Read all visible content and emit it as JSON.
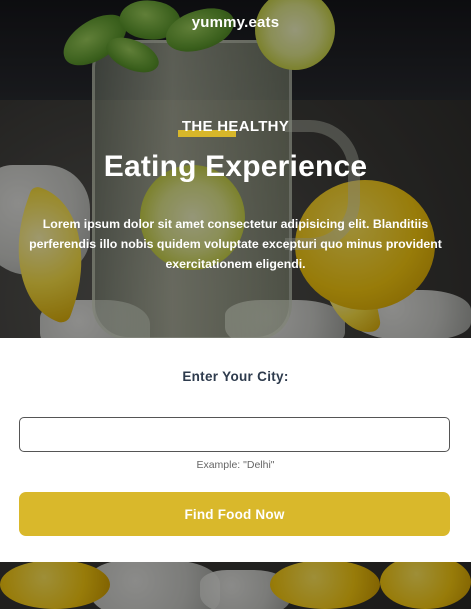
{
  "header": {
    "brand": "yummy.eats"
  },
  "hero": {
    "subtitle": "THE HEALTHY",
    "title": "Eating Experience",
    "description": "Lorem ipsum dolor sit amet consectetur adipisicing elit. Blanditiis perferendis illo nobis quidem voluptate excepturi quo minus provident exercitationem eligendi.",
    "accent_color": "#d8b72a"
  },
  "search_form": {
    "city_label": "Enter Your City:",
    "city_input_value": "",
    "example_hint": "Example: \"Delhi\"",
    "submit_label": "Find Food Now",
    "button_color": "#d9b82b"
  }
}
